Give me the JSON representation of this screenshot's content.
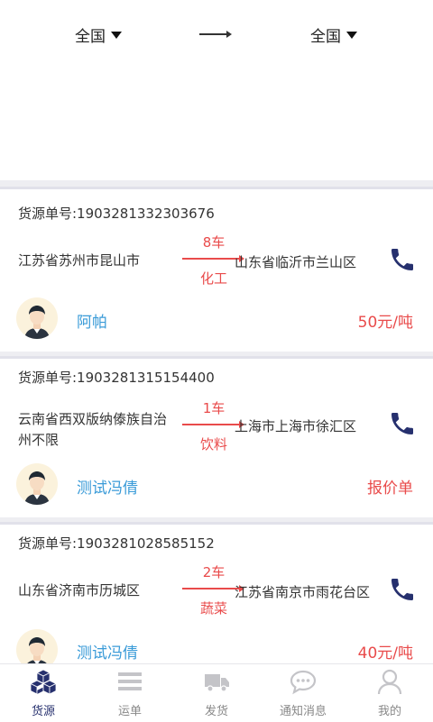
{
  "filter": {
    "from": "全国",
    "to": "全国"
  },
  "cards": [
    {
      "number_label": "货源单号:1903281332303676",
      "from": "江苏省苏州市昆山市",
      "trucks": "8车",
      "cargo": "化工",
      "to": "山东省临沂市兰山区",
      "name": "阿帕",
      "price": "50元/吨"
    },
    {
      "number_label": "货源单号:1903281315154400",
      "from": "云南省西双版纳傣族自治州不限",
      "trucks": "1车",
      "cargo": "饮料",
      "to": "上海市上海市徐汇区",
      "name": "测试冯倩",
      "price": "报价单"
    },
    {
      "number_label": "货源单号:1903281028585152",
      "from": "山东省济南市历城区",
      "trucks": "2车",
      "cargo": "蔬菜",
      "to": "江苏省南京市雨花台区",
      "name": "测试冯倩",
      "price": "40元/吨"
    }
  ],
  "tabs": [
    {
      "label": "货源",
      "icon": "cubes-icon",
      "active": true
    },
    {
      "label": "运单",
      "icon": "list-icon",
      "active": false
    },
    {
      "label": "发货",
      "icon": "truck-icon",
      "active": false
    },
    {
      "label": "通知消息",
      "icon": "chat-icon",
      "active": false
    },
    {
      "label": "我的",
      "icon": "user-icon",
      "active": false
    }
  ],
  "colors": {
    "accent": "#26306e",
    "price": "#e94b4b",
    "name": "#3a9bd8",
    "phone": "#26306e"
  }
}
